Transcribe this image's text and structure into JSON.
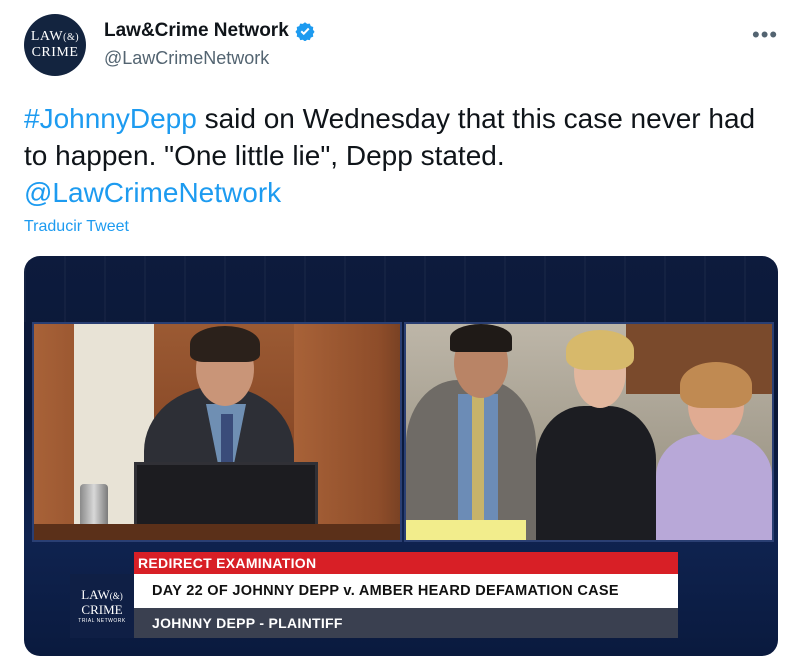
{
  "header": {
    "avatar_line1": "LAW",
    "avatar_amp": "&",
    "avatar_line2": "CRIME",
    "display_name": "Law&Crime Network",
    "handle": "@LawCrimeNetwork",
    "more_label": "•••",
    "verified_icon": "verified-badge-icon",
    "verified_color": "#1d9bf0"
  },
  "tweet": {
    "hashtag": "#JohnnyDepp",
    "text_part": " said on Wednesday that this case never had to happen. \"One little lie\", Depp stated.",
    "mention": "@LawCrimeNetwork",
    "translate_label": "Traducir Tweet"
  },
  "media": {
    "lower_third_red": "REDIRECT EXAMINATION",
    "lower_third_white": "DAY 22 OF JOHNNY DEPP v. AMBER HEARD DEFAMATION CASE",
    "lower_third_dark": "JOHNNY DEPP - PLAINTIFF",
    "logo_line1": "LAW",
    "logo_amp": "&",
    "logo_line2": "CRIME",
    "logo_sub": "TRIAL NETWORK"
  },
  "colors": {
    "link": "#1d9bf0",
    "secondary_text": "#536471",
    "red_banner": "#d81f26"
  }
}
